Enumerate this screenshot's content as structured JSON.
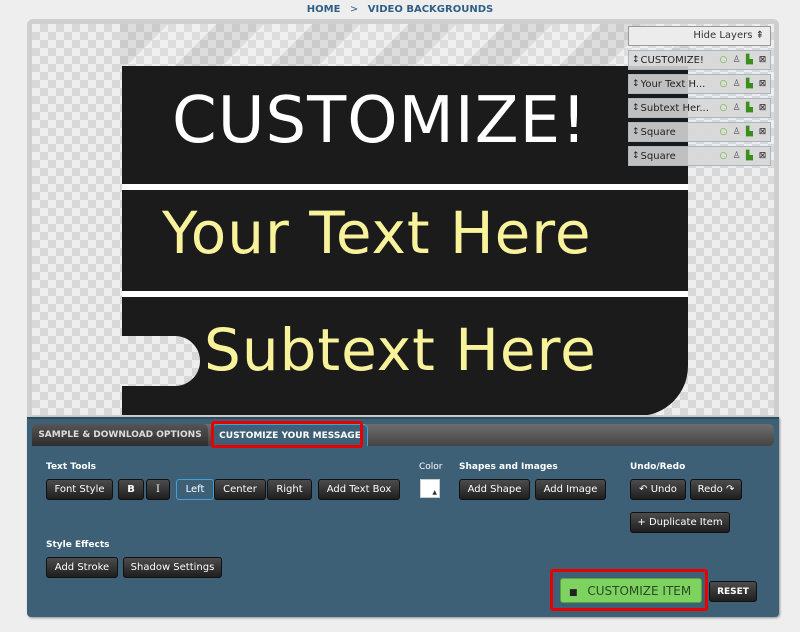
{
  "breadcrumb": {
    "home": "HOME",
    "separator": ">",
    "current": "VIDEO BACKGROUNDS"
  },
  "canvas": {
    "headline": "CUSTOMIZE!",
    "line_text": "Your Text Here",
    "subtext": "Subtext Here",
    "headline_color": "#ffffff",
    "text_color": "#f8f29a",
    "board_color": "#1b1b1b"
  },
  "layers": {
    "toggle_label": "Hide Layers",
    "toggle_icon": "⇞",
    "drag_icon": "↕",
    "items": [
      {
        "name": "CUSTOMIZE!"
      },
      {
        "name": "Your Text H..."
      },
      {
        "name": "Subtext Her..."
      },
      {
        "name": "Square"
      },
      {
        "name": "Square"
      }
    ]
  },
  "tabs": [
    {
      "label": "SAMPLE & DOWNLOAD OPTIONS",
      "active": false
    },
    {
      "label": "CUSTOMIZE YOUR MESSAGE",
      "active": true
    }
  ],
  "text_tools": {
    "label": "Text Tools",
    "font_style": "Font Style",
    "bold": "B",
    "italic": "I",
    "left": "Left",
    "center": "Center",
    "right": "Right",
    "add_text_box": "Add Text Box",
    "active_alignment": "Left"
  },
  "color": {
    "label": "Color",
    "value": "#ffffff"
  },
  "shapes_images": {
    "label": "Shapes and Images",
    "add_shape": "Add Shape",
    "add_image": "Add Image"
  },
  "undo_redo": {
    "label": "Undo/Redo",
    "undo": "Undo",
    "redo": "Redo",
    "duplicate": "Duplicate Item"
  },
  "style_effects": {
    "label": "Style Effects",
    "add_stroke": "Add Stroke",
    "shadow_settings": "Shadow Settings"
  },
  "actions": {
    "customize_item": "CUSTOMIZE ITEM",
    "reset": "RESET"
  },
  "colors": {
    "panel": "#3d6077",
    "highlight": "#e80000",
    "customize_button": "#7ed360",
    "active_tab_border": "#42a2d6"
  }
}
